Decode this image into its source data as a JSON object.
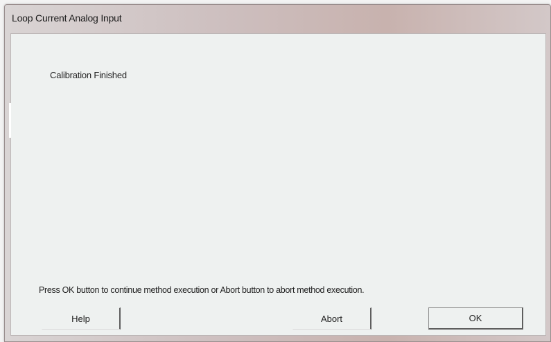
{
  "window": {
    "title": "Loop Current Analog Input"
  },
  "content": {
    "status": "Calibration Finished",
    "instruction": "Press OK button to continue method execution or Abort button to abort method execution."
  },
  "buttons": {
    "help": "Help",
    "abort": "Abort",
    "ok": "OK"
  }
}
